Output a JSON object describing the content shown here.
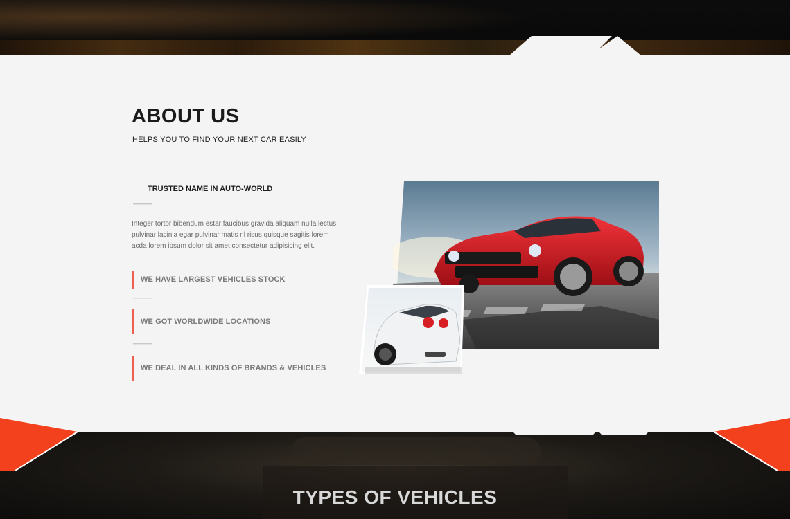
{
  "about": {
    "title": "ABOUT US",
    "subtitle": "HELPS YOU TO FIND YOUR NEXT CAR EASILY",
    "feature_heading": "TRUSTED NAME IN AUTO-WORLD",
    "body": "Integer tortor bibendum estar faucibus gravida aliquam nulla lectus pulvinar lacinia egar pulvinar matis nl risus quisque sagitis lorem acda lorem ipsum dolor sit amet consectetur adipisicing elit.",
    "features": [
      "WE HAVE LARGEST VEHICLES STOCK",
      "WE GOT WORLDWIDE LOCATIONS",
      "WE DEAL IN ALL KINDS OF BRANDS & VEHICLES"
    ],
    "main_image_alt": "red-sports-car-photo",
    "small_image_alt": "white-sports-car-photo"
  },
  "vehicles": {
    "title": "TYPES OF VEHICLES",
    "subtitle": ""
  },
  "colors": {
    "accent": "#f0604e",
    "accent_band": "#f2411c",
    "section_bg": "#f4f4f4",
    "dark": "#1b1b1b"
  }
}
